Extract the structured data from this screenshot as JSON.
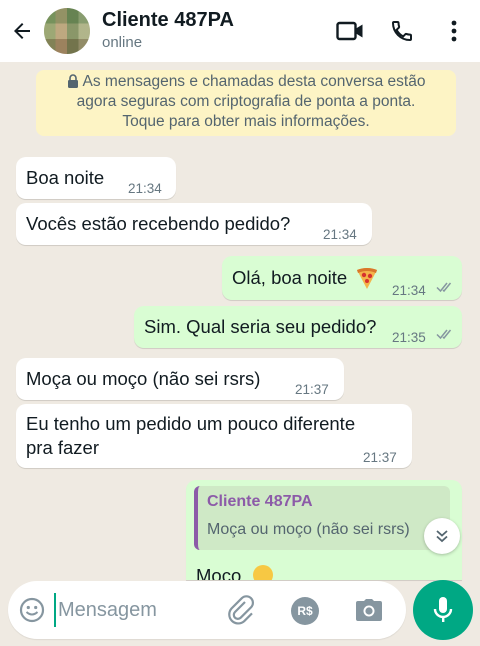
{
  "header": {
    "contact_name": "Cliente 487PA",
    "status": "online",
    "icons": [
      "back-arrow-icon",
      "video-call-icon",
      "phone-icon",
      "more-vert-icon"
    ]
  },
  "notice": {
    "line1": "As mensagens e chamadas desta conversa estão",
    "line2": "agora seguras com criptografia de ponta a ponta.",
    "line3": "Toque para obter mais informações."
  },
  "messages": [
    {
      "direction": "in",
      "text": "Boa noite",
      "time": "21:34"
    },
    {
      "direction": "in",
      "text": "Vocês estão recebendo pedido?",
      "time": "21:34"
    },
    {
      "direction": "out",
      "text": "Olá, boa noite",
      "emoji": "pizza",
      "time": "21:34",
      "read": true
    },
    {
      "direction": "out",
      "text": "Sim. Qual seria seu pedido?",
      "time": "21:35",
      "read": true
    },
    {
      "direction": "in",
      "text": "Moça ou moço (não sei rsrs)",
      "time": "21:37"
    },
    {
      "direction": "in",
      "line1": "Eu tenho um pedido um pouco diferente",
      "line2": "pra fazer",
      "time": "21:37"
    },
    {
      "direction": "out",
      "quote_name": "Cliente 487PA",
      "quote_text": "Moça ou moço (não sei rsrs)",
      "partial_text": "Moço"
    }
  ],
  "composer": {
    "placeholder": "Mensagem",
    "currency_label": "R$",
    "icons": [
      "emoji-icon",
      "attach-icon",
      "payment-icon",
      "camera-icon",
      "mic-icon"
    ]
  },
  "colors": {
    "accent": "#00a884",
    "outgoing_bubble": "#d9fdd3",
    "incoming_bubble": "#ffffff",
    "chat_background": "#efeae2",
    "notice_background": "#fdf4c5",
    "quote_name": "#8c5ba8",
    "read_ticks": "#8696a0"
  }
}
